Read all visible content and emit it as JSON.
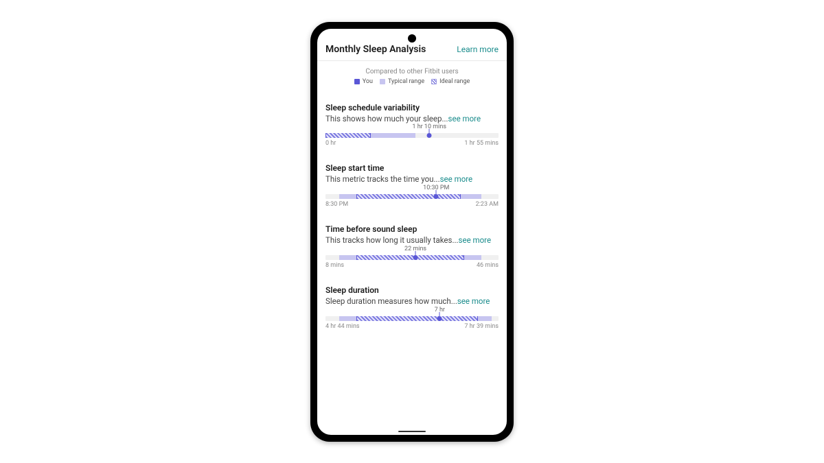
{
  "header": {
    "title": "Monthly Sleep Analysis",
    "learn_more": "Learn more"
  },
  "subheader": "Compared to other Fitbit users",
  "legend": {
    "you": "You",
    "typical": "Typical range",
    "ideal": "Ideal range"
  },
  "see_more": "see more",
  "metrics": [
    {
      "title": "Sleep schedule variability",
      "desc": "This shows how much your sleep...",
      "value_label": "1 hr 10 mins",
      "min_label": "0 hr",
      "max_label": "1 hr 55 mins"
    },
    {
      "title": "Sleep start time",
      "desc": "This metric tracks the time you...",
      "value_label": "10:30 PM",
      "min_label": "8:30 PM",
      "max_label": "2:23 AM"
    },
    {
      "title": "Time before sound sleep",
      "desc": "This tracks how long it usually takes...",
      "value_label": "22 mins",
      "min_label": "8 mins",
      "max_label": "46 mins"
    },
    {
      "title": "Sleep duration",
      "desc": "Sleep duration measures how much...",
      "value_label": "7 hr",
      "min_label": "4 hr 44 mins",
      "max_label": "7 hr 39 mins"
    }
  ],
  "chart_data": [
    {
      "type": "bar",
      "title": "Sleep schedule variability",
      "xlabel": "",
      "ylabel": "",
      "min": "0 hr",
      "max": "1 hr 55 mins",
      "value": "1 hr 10 mins",
      "value_pct": 60,
      "ideal_pct": [
        0,
        26
      ],
      "typical_pct": [
        26,
        52
      ]
    },
    {
      "type": "bar",
      "title": "Sleep start time",
      "xlabel": "",
      "ylabel": "",
      "min": "8:30 PM",
      "max": "2:23 AM",
      "value": "10:30 PM",
      "value_pct": 64,
      "ideal_pct": [
        18,
        78
      ],
      "typical_pct": [
        8,
        90
      ]
    },
    {
      "type": "bar",
      "title": "Time before sound sleep",
      "xlabel": "",
      "ylabel": "",
      "min": "8 mins",
      "max": "46 mins",
      "value": "22 mins",
      "value_pct": 52,
      "ideal_pct": [
        18,
        80
      ],
      "typical_pct": [
        8,
        90
      ]
    },
    {
      "type": "bar",
      "title": "Sleep duration",
      "xlabel": "",
      "ylabel": "",
      "min": "4 hr 44 mins",
      "max": "7 hr 39 mins",
      "value": "7 hr",
      "value_pct": 66,
      "ideal_pct": [
        18,
        88
      ],
      "typical_pct": [
        8,
        96
      ]
    }
  ]
}
